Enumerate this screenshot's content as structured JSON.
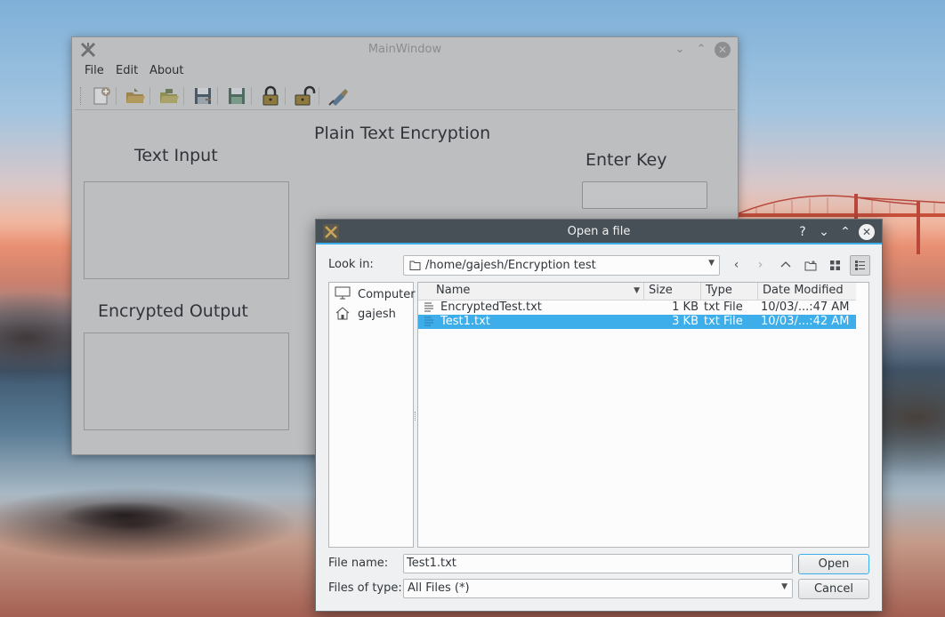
{
  "main_window": {
    "title": "MainWindow",
    "menu": [
      "File",
      "Edit",
      "About"
    ],
    "heading": "Plain Text Encryption",
    "text_input_label": "Text Input",
    "enter_key_label": "Enter Key",
    "encrypted_output_label": "Encrypted Output",
    "toolbar": [
      "new-file-icon",
      "open-folder-icon",
      "open-folder-green-icon",
      "save-icon",
      "save-as-icon",
      "lock-icon",
      "unlock-icon",
      "clear-brush-icon"
    ]
  },
  "dialog": {
    "title": "Open a file",
    "title_buttons": [
      "?",
      "⌄",
      "⌃",
      "✕"
    ],
    "look_in_label": "Look in:",
    "look_in_path": "/home/gajesh/Encryption test",
    "sidebar": [
      {
        "label": "Computer",
        "icon": "computer-icon"
      },
      {
        "label": "gajesh",
        "icon": "home-icon"
      }
    ],
    "columns": [
      "Name",
      "Size",
      "Type",
      "Date Modified"
    ],
    "files": [
      {
        "name": "EncryptedTest.txt",
        "size": "1 KB",
        "type": "txt File",
        "modified": "10/03/...:47 AM",
        "selected": false
      },
      {
        "name": "Test1.txt",
        "size": "3 KB",
        "type": "txt File",
        "modified": "10/03/...:42 AM",
        "selected": true
      }
    ],
    "file_name_label": "File name:",
    "file_name_value": "Test1.txt",
    "files_of_type_label": "Files of type:",
    "files_of_type_value": "All Files (*)",
    "open_button": "Open",
    "cancel_button": "Cancel"
  },
  "colors": {
    "accent": "#3daee9",
    "dialog_titlebar": "#475057",
    "window_bg": "#eff0f1"
  }
}
